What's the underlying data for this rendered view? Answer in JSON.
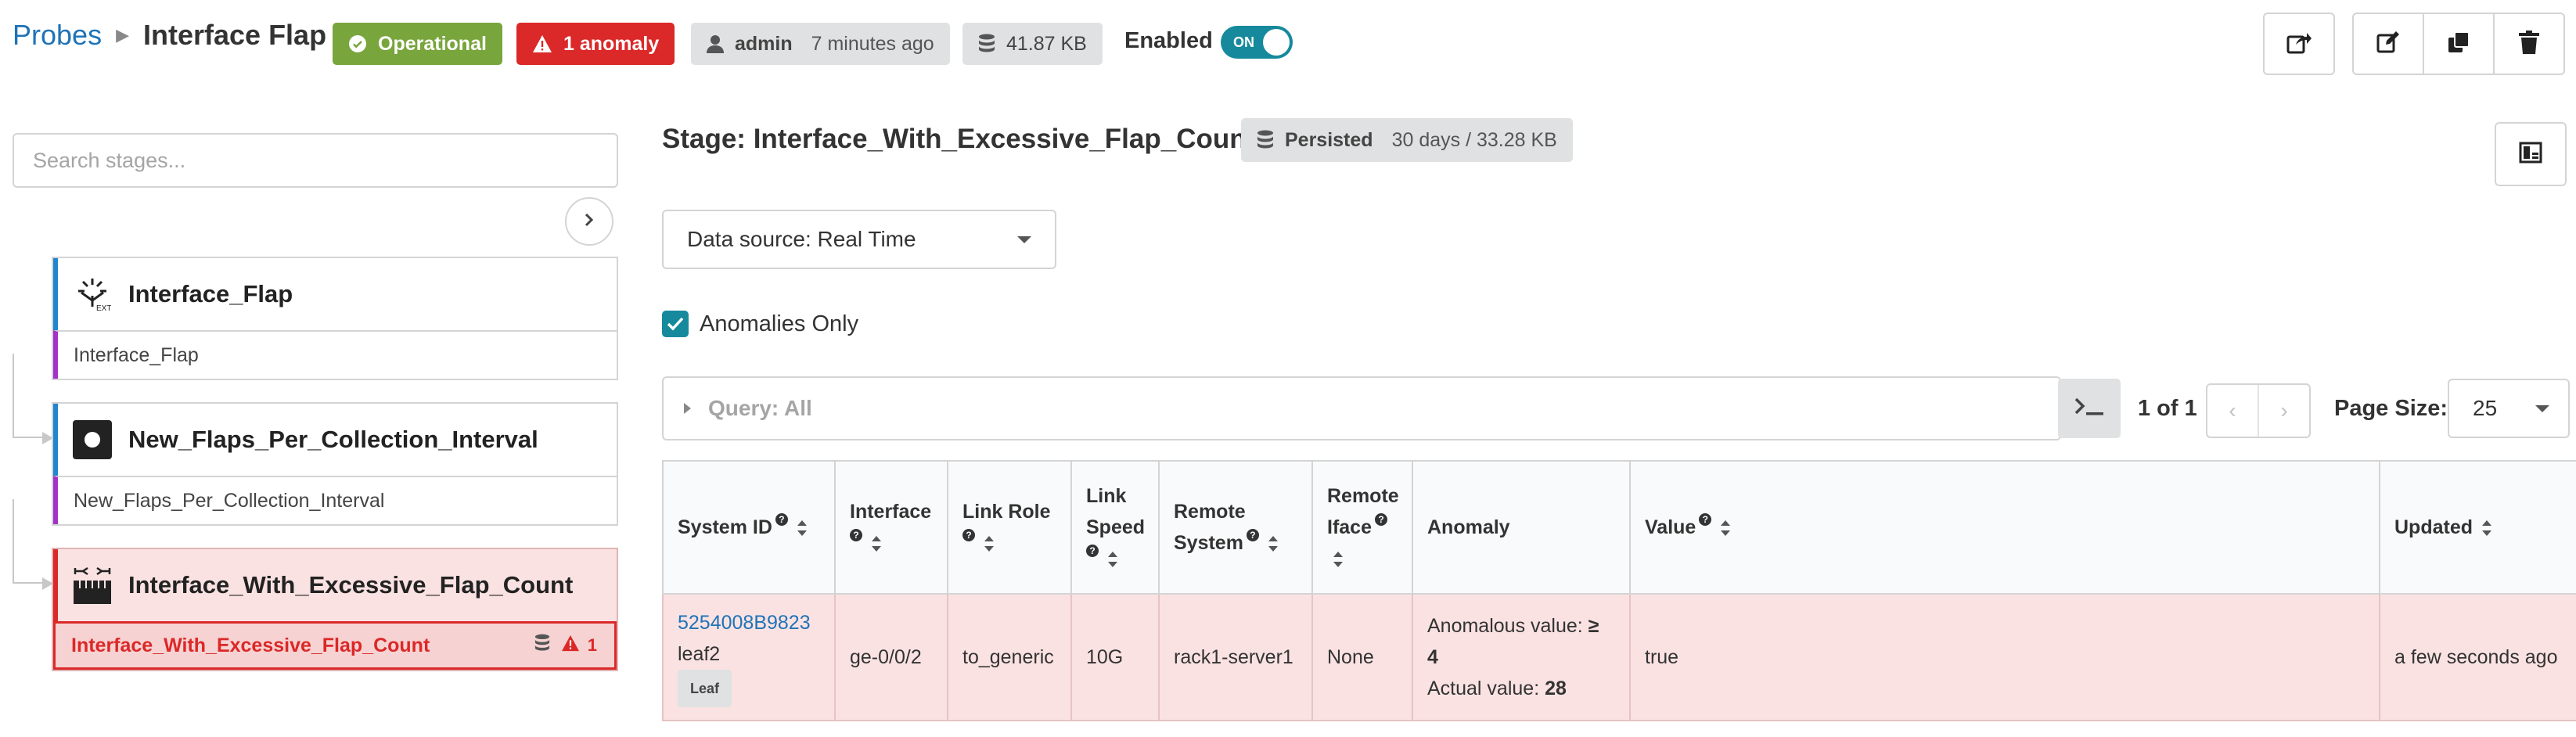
{
  "header": {
    "breadcrumb_root": "Probes",
    "title": "Interface Flap",
    "status_badge": "Operational",
    "anomaly_badge": "1 anomaly",
    "user": "admin",
    "user_time": "7 minutes ago",
    "size": "41.87 KB",
    "enabled_label": "Enabled",
    "toggle_text": "ON",
    "toolbar_icons": [
      "share-icon",
      "edit-icon",
      "clone-icon",
      "trash-icon"
    ]
  },
  "sidebar": {
    "search_placeholder": "Search stages...",
    "stages": [
      {
        "name": "Interface_Flap",
        "sub": "Interface_Flap",
        "icon": "extensible-icon"
      },
      {
        "name": "New_Flaps_Per_Collection_Interval",
        "sub": "New_Flaps_Per_Collection_Interval",
        "icon": "record-icon"
      },
      {
        "name": "Interface_With_Excessive_Flap_Count",
        "sub": "Interface_With_Excessive_Flap_Count",
        "icon": "range-icon",
        "anomaly_count": "1"
      }
    ]
  },
  "main": {
    "stage_title": "Stage: Interface_With_Excessive_Flap_Count",
    "persisted_label": "Persisted",
    "persisted_detail": "30 days / 33.28 KB",
    "data_source": "Data source: Real Time",
    "anomalies_only": "Anomalies Only",
    "query": "Query: All",
    "pager_text": "1 of 1",
    "page_size_label": "Page Size:",
    "page_size": "25",
    "table": {
      "headers": {
        "system_id": "System ID",
        "interface": "Interface",
        "link_role": "Link Role",
        "link_speed_1": "Link",
        "link_speed_2": "Speed",
        "remote_system_1": "Remote",
        "remote_system_2": "System",
        "remote_iface_1": "Remote",
        "remote_iface_2": "Iface",
        "anomaly": "Anomaly",
        "value": "Value",
        "updated": "Updated"
      },
      "rows": [
        {
          "system_id": "5254008B9823",
          "hostname": "leaf2",
          "role_tag": "Leaf",
          "interface": "ge-0/0/2",
          "link_role": "to_generic",
          "link_speed": "10G",
          "remote_system": "rack1-server1",
          "remote_iface": "None",
          "anomalous_label": "Anomalous value:",
          "anomalous_value": "≥ 4",
          "actual_label": "Actual value:",
          "actual_value": "28",
          "value": "true",
          "updated": "a few seconds ago"
        }
      ]
    }
  },
  "colors": {
    "accent": "#168a9c",
    "link": "#1e73b7",
    "operational": "#78a53c",
    "anomaly": "#db2828",
    "anomaly_row_bg": "#fbe2e2"
  }
}
